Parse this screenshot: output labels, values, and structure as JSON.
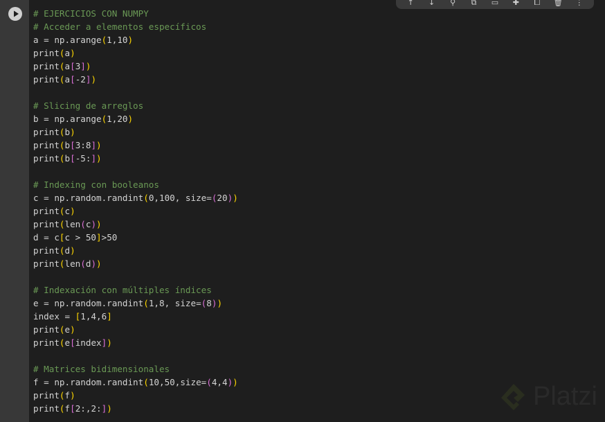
{
  "cell": {
    "run_button_label": "Run cell",
    "lines": [
      "# EJERCICIOS CON NUMPY",
      "# Acceder a elementos específicos",
      "a = np.arange(1,10)",
      "print(a)",
      "print(a[3])",
      "print(a[-2])",
      "",
      "# Slicing de arreglos",
      "b = np.arange(1,20)",
      "print(b)",
      "print(b[3:8])",
      "print(b[-5:])",
      "",
      "# Indexing con booleanos",
      "c = np.random.randint(0,100, size=(20))",
      "print(c)",
      "print(len(c))",
      "d = c[c > 50]>50",
      "print(d)",
      "print(len(d))",
      "",
      "# Indexación con múltiples índices",
      "e = np.random.randint(1,8, size=(8))",
      "index = [1,4,6]",
      "print(e)",
      "print(e[index])",
      "",
      "# Matrices bidimensionales",
      "f = np.random.randint(10,50,size=(4,4))",
      "print(f)",
      "print(f[2:,2:])"
    ]
  },
  "toolbar": {
    "icons": [
      "arrow-up-icon",
      "arrow-down-icon",
      "link-icon",
      "copy-link-icon",
      "comment-icon",
      "settings-icon",
      "mirror-icon",
      "delete-icon",
      "more-icon"
    ],
    "glyphs": [
      "↑",
      "↓",
      "⚲",
      "⧉",
      "▭",
      "✚",
      "⧠",
      "🗑",
      "⋮"
    ]
  },
  "watermark": {
    "text": "Platzi"
  },
  "colors": {
    "comment": "#6a9955",
    "bracket_level_1": "#ffd700",
    "bracket_level_2": "#da70d6",
    "bracket_level_3": "#179fff",
    "text": "#d4d4d4"
  }
}
